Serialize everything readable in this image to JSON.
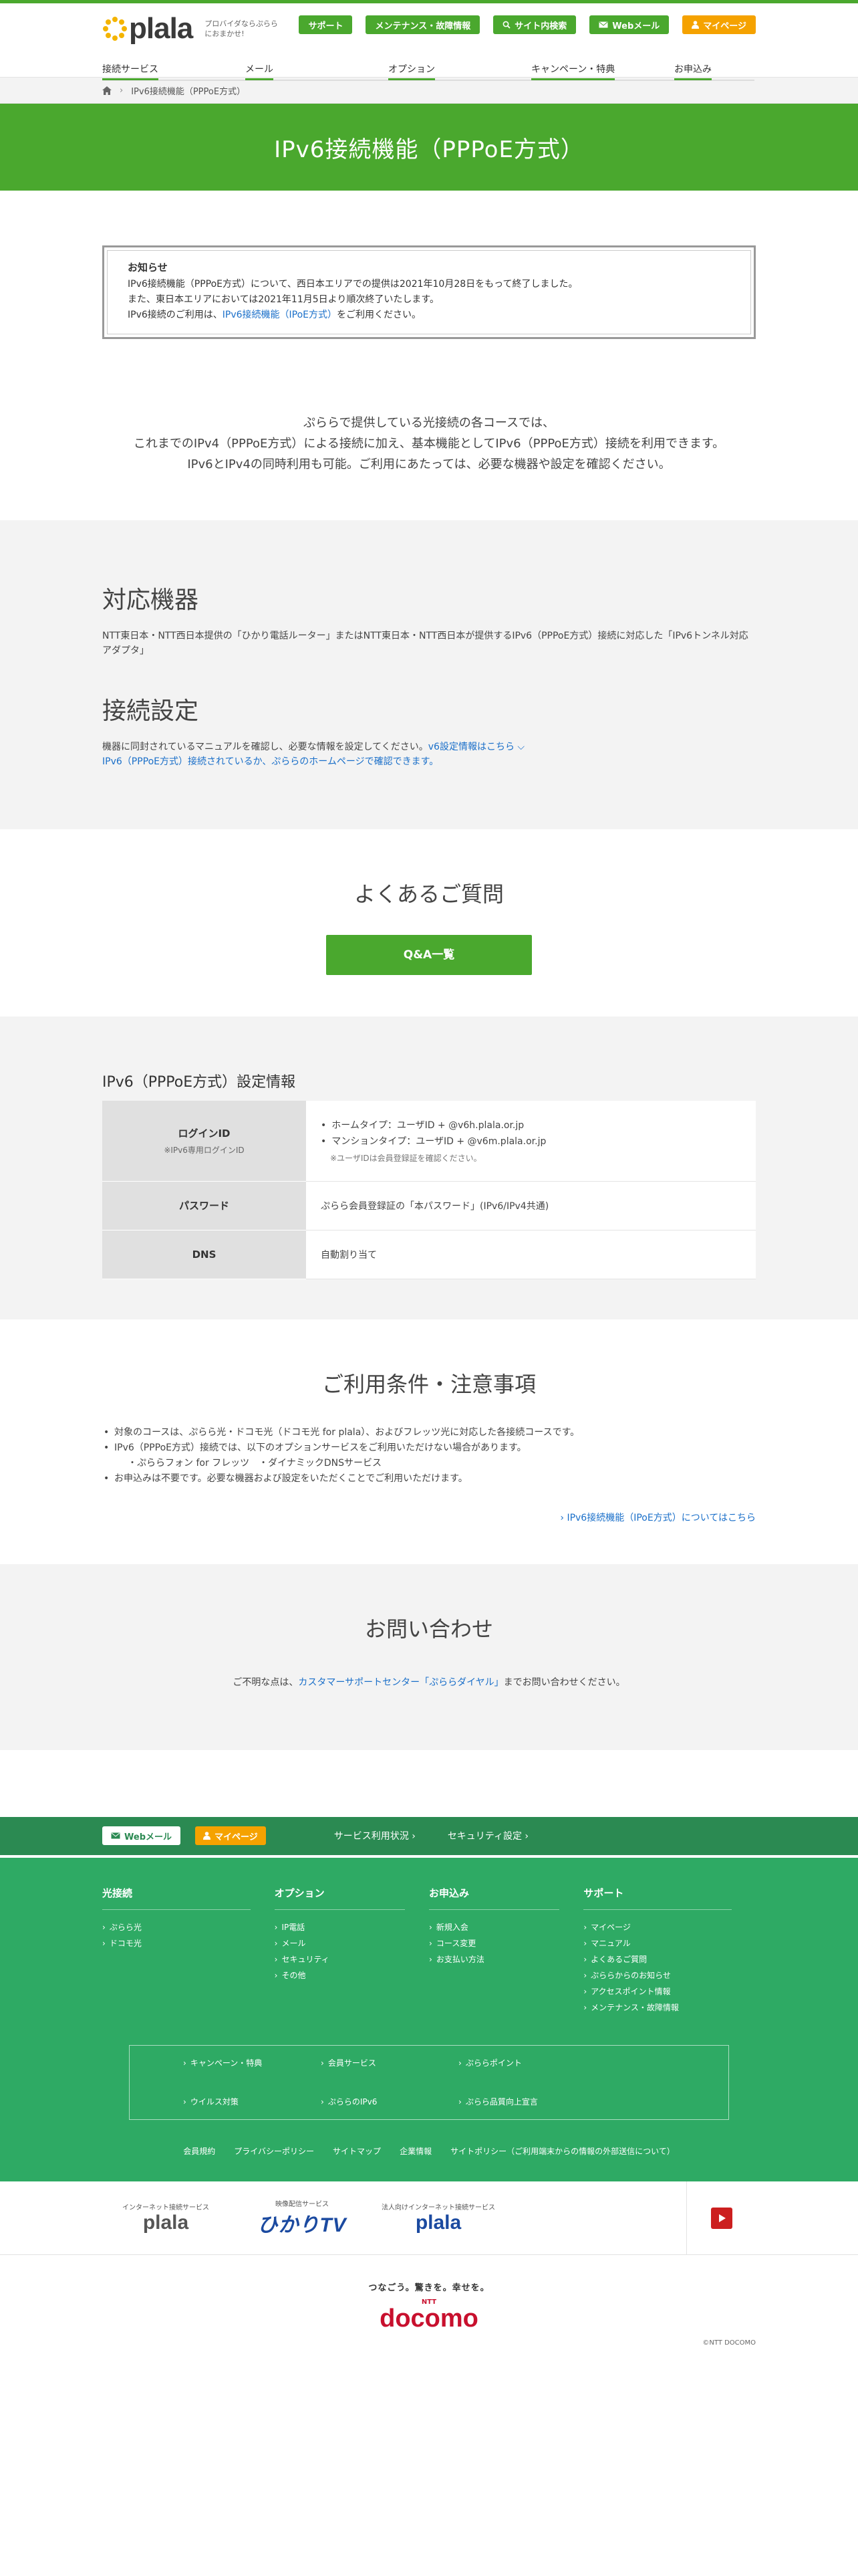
{
  "header": {
    "logo_text": "plala",
    "tagline_1": "プロバイダならぷららにおまかせ!",
    "util_buttons": [
      "サポート",
      "メンテナンス・故障情報",
      "サイト内検索",
      "Webメール",
      "マイページ"
    ],
    "nav": [
      "接続サービス",
      "メール",
      "オプション",
      "キャンペーン・特典",
      "お申込み"
    ]
  },
  "breadcrumb": {
    "current": "IPv6接続機能（PPPoE方式）"
  },
  "hero": {
    "title": "IPv6接続機能（PPPoE方式）"
  },
  "notice": {
    "title": "お知らせ",
    "line1": "IPv6接続機能（PPPoE方式）について、西日本エリアでの提供は2021年10月28日をもって終了しました。",
    "line2": "また、東日本エリアにおいては2021年11月5日より順次終了いたします。",
    "line3_pre": "IPv6接続のご利用は、",
    "line3_link": "IPv6接続機能（IPoE方式）",
    "line3_post": "をご利用ください。"
  },
  "intro": {
    "line1": "ぷららで提供している光接続の各コースでは、",
    "line2": "これまでのIPv4（PPPoE方式）による接続に加え、基本機能としてIPv6（PPPoE方式）接続を利用できます。",
    "line3": "IPv6とIPv4の同時利用も可能。ご利用にあたっては、必要な機器や設定を確認ください。"
  },
  "devices": {
    "title": "対応機器",
    "text": "NTT東日本・NTT西日本提供の「ひかり電話ルーター」またはNTT東日本・NTT西日本が提供するIPv6（PPPoE方式）接続に対応した「IPv6トンネル対応アダプタ」",
    "setup_title": "接続設定",
    "setup_text": "機器に同封されているマニュアルを確認し、必要な情報を設定してください。",
    "setup_link1": "v6設定情報はこちら ⌵",
    "setup_link2": "IPv6（PPPoE方式）接続されているか、ぷららのホームページで確認できます。"
  },
  "faq": {
    "title": "よくあるご質問",
    "button": "Q&A一覧"
  },
  "settings": {
    "title": "IPv6（PPPoE方式）設定情報",
    "rows": {
      "login_label": "ログインID",
      "login_sub": "※IPv6専用ログインID",
      "login_home": "ホームタイプ：ユーザID + @v6h.plala.or.jp",
      "login_mansion": "マンションタイプ：ユーザID + @v6m.plala.or.jp",
      "login_note": "※ユーザIDは会員登録証を確認ください。",
      "password_label": "パスワード",
      "password_value": "ぷらら会員登録証の「本パスワード」(IPv6/IPv4共通)",
      "dns_label": "DNS",
      "dns_value": "自動割り当て"
    }
  },
  "conditions": {
    "title": "ご利用条件・注意事項",
    "item1": "対象のコースは、ぷらら光・ドコモ光（ドコモ光 for plala）、およびフレッツ光に対応した各接続コースです。",
    "item2": "IPv6（PPPoE方式）接続では、以下のオプションサービスをご利用いただけない場合があります。",
    "item2_sub": "・ぷららフォン for フレッツ　・ダイナミックDNSサービス",
    "item3": "お申込みは不要です。必要な機器および設定をいただくことでご利用いただけます。",
    "more_link": "IPv6接続機能（IPoE方式）についてはこちら"
  },
  "contact": {
    "title": "お問い合わせ",
    "pre": "ご不明な点は、",
    "link": "カスタマーサポートセンター「ぷららダイヤル」",
    "post": "までお問い合わせください。"
  },
  "footer": {
    "webmail": "Webメール",
    "mypage": "マイページ",
    "link1": "サービス利用状況",
    "link2": "セキュリティ設定",
    "cols": [
      {
        "title": "光接続",
        "items": [
          "ぷらら光",
          "ドコモ光"
        ]
      },
      {
        "title": "オプション",
        "items": [
          "IP電話",
          "メール",
          "セキュリティ",
          "その他"
        ]
      },
      {
        "title": "お申込み",
        "items": [
          "新規入会",
          "コース変更",
          "お支払い方法"
        ]
      },
      {
        "title": "サポート",
        "items": [
          "マイページ",
          "マニュアル",
          "よくあるご質問",
          "ぷららからのお知らせ",
          "アクセスポイント情報",
          "メンテナンス・故障情報"
        ]
      }
    ],
    "box": [
      "キャンペーン・特典",
      "会員サービス",
      "ぷららポイント",
      "ウイルス対策",
      "ぷららのIPv6",
      "ぷらら品質向上宣言"
    ],
    "bottom": [
      "会員規約",
      "プライバシーポリシー",
      "サイトマップ",
      "企業情報",
      "サイトポリシー（ご利用端末からの情報の外部送信について）"
    ]
  },
  "brands": [
    {
      "label": "インターネット接続サービス",
      "name": "plala"
    },
    {
      "label": "映像配信サービス",
      "name": "ひかりTV"
    },
    {
      "label": "法人向けインターネット接続サービス",
      "name": "plala"
    }
  ],
  "docomo": {
    "slogan": "つなごう。驚きを。幸せを。",
    "ntt": "NTT",
    "logo": "docomo",
    "copyright": "©NTT DOCOMO"
  },
  "colors": {
    "brand_green": "#4aa82e",
    "footer_green": "#2eaa64",
    "accent_orange": "#f5a200"
  }
}
